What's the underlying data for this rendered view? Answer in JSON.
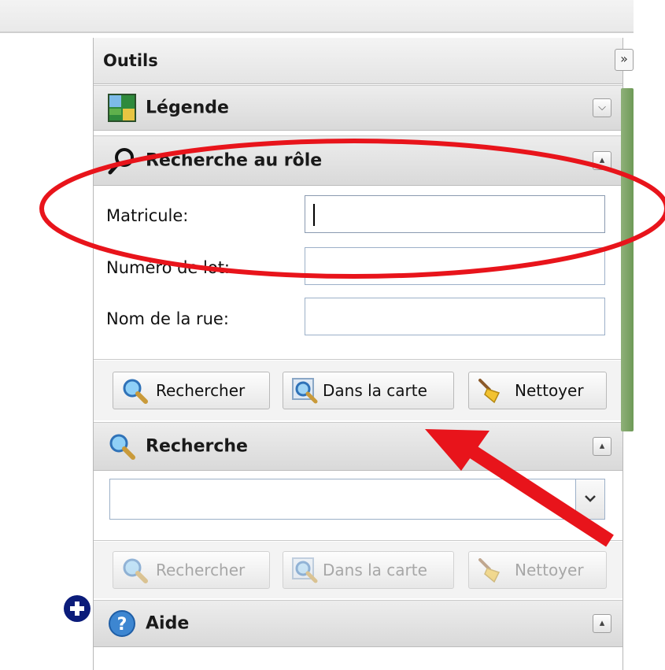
{
  "panel": {
    "title": "Outils",
    "expand_label": "»"
  },
  "sections": {
    "legende": {
      "title": "Légende"
    },
    "role": {
      "title": "Recherche au rôle",
      "fields": [
        {
          "label": "Matricule:",
          "value": ""
        },
        {
          "label": "Numéro de lot:",
          "value": ""
        },
        {
          "label": "Nom de la rue:",
          "value": ""
        }
      ],
      "buttons": {
        "search": "Rechercher",
        "map": "Dans la carte",
        "clear": "Nettoyer"
      }
    },
    "recherche": {
      "title": "Recherche",
      "combo_value": "",
      "buttons": {
        "search": "Rechercher",
        "map": "Dans la carte",
        "clear": "Nettoyer"
      }
    },
    "aide": {
      "title": "Aide"
    }
  },
  "annotation_colors": {
    "ellipse": "#e8141b",
    "arrow": "#e8141b"
  },
  "icons": [
    "legend-map-icon",
    "magnifier-icon",
    "search-icon",
    "map-search-icon",
    "broom-icon",
    "help-icon",
    "add-icon"
  ]
}
